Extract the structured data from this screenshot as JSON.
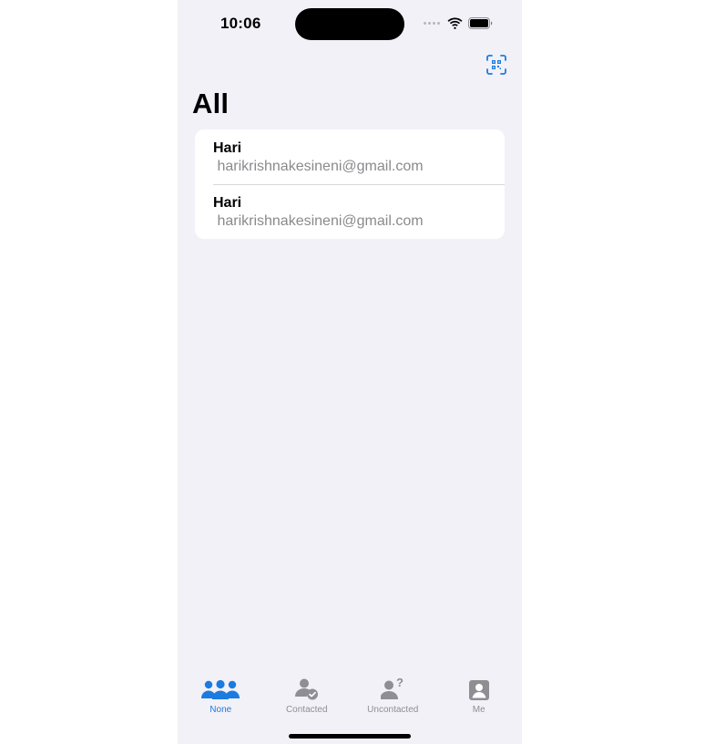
{
  "status_bar": {
    "time": "10:06"
  },
  "header": {
    "title": "All",
    "qr_icon": "qr-scan-icon"
  },
  "contacts": [
    {
      "name": "Hari",
      "email": " harikrishnakesineni@gmail.com"
    },
    {
      "name": "Hari",
      "email": " harikrishnakesineni@gmail.com"
    }
  ],
  "tabs": [
    {
      "label": "None",
      "icon": "people-group-icon",
      "active": true
    },
    {
      "label": "Contacted",
      "icon": "person-check-icon",
      "active": false
    },
    {
      "label": "Uncontacted",
      "icon": "person-question-icon",
      "active": false
    },
    {
      "label": "Me",
      "icon": "person-square-icon",
      "active": false
    }
  ],
  "colors": {
    "accent": "#1c7be0",
    "background": "#f2f1f7",
    "inactive": "#8e8e93"
  }
}
